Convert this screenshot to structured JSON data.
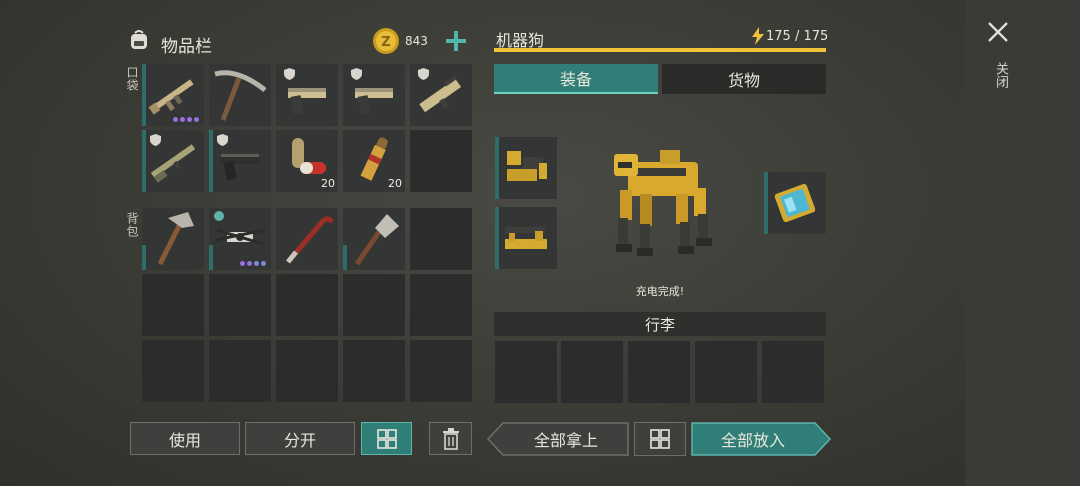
{
  "inventory": {
    "title": "物品栏",
    "coins": "843",
    "pocket_label": "口袋",
    "backpack_label": "背包",
    "pocket_qty_pills": "20",
    "pocket_qty_ammo": "20"
  },
  "robot": {
    "name": "机器狗",
    "energy": "175 / 175",
    "energy_fraction": 1.0,
    "tab_equipment": "装备",
    "tab_cargo": "货物",
    "status": "充电完成!",
    "luggage_label": "行李"
  },
  "close_label": "关闭",
  "buttons": {
    "use": "使用",
    "split": "分开",
    "take_all": "全部拿上",
    "put_all": "全部放入"
  },
  "colors": {
    "accent": "#2f7f78",
    "energy": "#f0c43a",
    "rarity": "#9a6fe0"
  }
}
